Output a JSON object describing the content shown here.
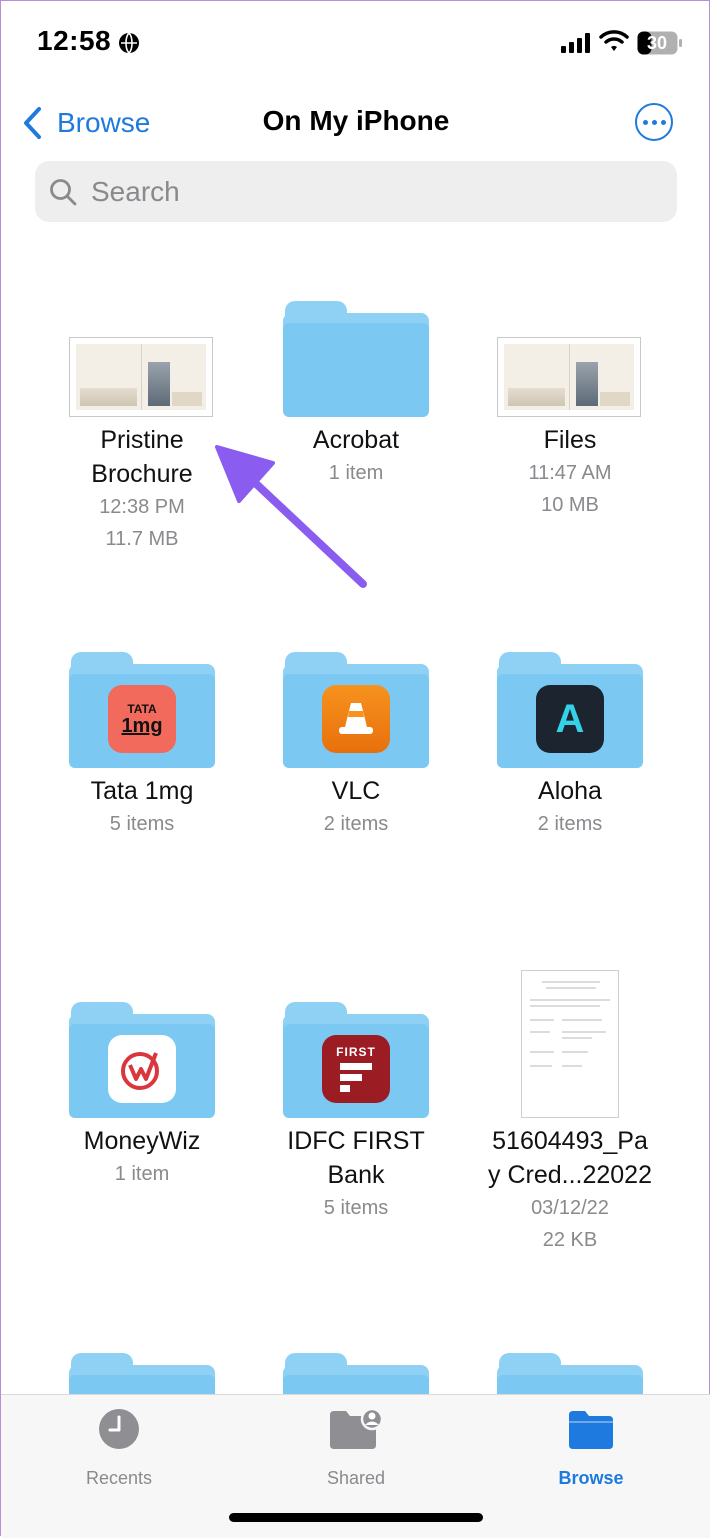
{
  "status": {
    "time": "12:58",
    "battery": "30"
  },
  "nav": {
    "back_label": "Browse",
    "title": "On My iPhone"
  },
  "search": {
    "placeholder": "Search"
  },
  "items": [
    {
      "name": "Pristine\nBrochure",
      "meta1": "12:38 PM",
      "meta2": "11.7 MB"
    },
    {
      "name": "Acrobat",
      "meta1": "1 item",
      "meta2": ""
    },
    {
      "name": "Files",
      "meta1": "11:47 AM",
      "meta2": "10 MB"
    },
    {
      "name": "Tata 1mg",
      "meta1": "5 items",
      "meta2": "",
      "icon_text_top": "TATA",
      "icon_text_bottom": "1mg"
    },
    {
      "name": "VLC",
      "meta1": "2 items",
      "meta2": ""
    },
    {
      "name": "Aloha",
      "meta1": "2 items",
      "meta2": "",
      "icon_letter": "A"
    },
    {
      "name": "MoneyWiz",
      "meta1": "1 item",
      "meta2": ""
    },
    {
      "name": "IDFC FIRST\nBank",
      "meta1": "5 items",
      "meta2": "",
      "icon_text": "FIRST"
    },
    {
      "name": "51604493_Pa\ny Cred...22022",
      "meta1": "03/12/22",
      "meta2": "22 KB"
    }
  ],
  "tabbar": {
    "recents": "Recents",
    "shared": "Shared",
    "browse": "Browse"
  },
  "colors": {
    "accent": "#1f7ae0",
    "folder": "#8fd0f5",
    "arrow": "#8a5cf0"
  }
}
